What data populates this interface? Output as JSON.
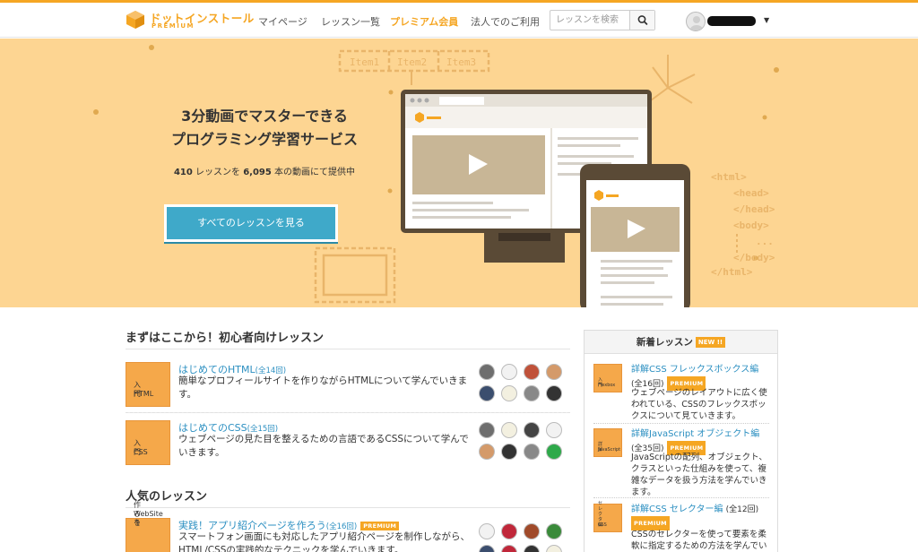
{
  "header": {
    "logo_text": "ドットインストール",
    "logo_sub": "PREMIUM",
    "nav": [
      {
        "label": "マイページ",
        "active": false
      },
      {
        "label": "レッスン一覧",
        "active": false
      },
      {
        "label": "プレミアム会員",
        "active": true
      },
      {
        "label": "法人でのご利用",
        "active": false
      }
    ],
    "search_placeholder": "レッスンを検索",
    "search_icon": "search-icon",
    "user_caret": "▼"
  },
  "hero": {
    "title_line1": "3分動画でマスターできる",
    "title_line2": "プログラミング学習サービス",
    "lesson_count": "410",
    "stats_mid": " レッスンを ",
    "video_count": "6,095",
    "stats_end": " 本の動画にて提供中",
    "cta_label": "すべてのレッスンを見る",
    "illustration": {
      "items": [
        "Item1",
        "Item2",
        "Item3"
      ],
      "code": [
        "<html>",
        "<head>",
        "</head>",
        "<body>",
        "...",
        "</body>",
        "</html>"
      ]
    }
  },
  "beginner": {
    "title": "まずはここから！初心者向けレッスン",
    "lessons": [
      {
        "thumb": [
          "HTML",
          "入門"
        ],
        "title": "はじめてのHTML",
        "count": "(全14回)",
        "desc": "簡単なプロフィールサイトを作りながらHTMLについて学んでいきます。",
        "premium": false
      },
      {
        "thumb": [
          "CSS",
          "入門"
        ],
        "title": "はじめてのCSS",
        "count": "(全15回)",
        "desc": "ウェブページの見た目を整えるための言語であるCSSについて学んでいきます。",
        "premium": false
      }
    ]
  },
  "popular": {
    "title": "人気のレッスン",
    "lessons": [
      {
        "thumb": [
          "WebSiteを",
          "作ろう"
        ],
        "title": "実践！アプリ紹介ページを作ろう",
        "count": "(全16回)",
        "desc": "スマートフォン画面にも対応したアプリ紹介ページを制作しながら、HTML/CSSの実践的なテクニックを学んでいきます。",
        "premium": true,
        "premium_label": "PREMIUM"
      }
    ]
  },
  "sidebar": {
    "title": "新着レッスン",
    "new_badge": "NEW !!",
    "items": [
      {
        "thumb": [
          "Flexbox",
          "入門"
        ],
        "title": "詳解CSS フレックスボックス編",
        "count": "(全16回)",
        "premium": true,
        "premium_label": "PREMIUM",
        "desc": "ウェブページのレイアウトに広く使われている、CSSのフレックスボックスについて見ていきます。"
      },
      {
        "thumb": [
          "詳解",
          "JavaScript"
        ],
        "title": "詳解JavaScript オブジェクト編",
        "count": "(全35回)",
        "premium": true,
        "premium_label": "PREMIUM",
        "desc": "JavaScriptの配列、オブジェクト、クラスといった仕組みを使って、複雑なデータを扱う方法を学んでいきます。"
      },
      {
        "thumb": [
          "CSS",
          "セレクタ編"
        ],
        "title": "詳解CSS セレクター編",
        "count": "(全12回)",
        "premium": true,
        "premium_label": "PREMIUM",
        "desc": "CSSのセレクターを使って要素を柔軟に指定するための方法を学んでいきます。"
      }
    ]
  },
  "colors": {
    "accent": "#f5a623",
    "hero_bg": "#fdd592",
    "cta": "#3fa9c9",
    "link": "#2b8fc1"
  }
}
